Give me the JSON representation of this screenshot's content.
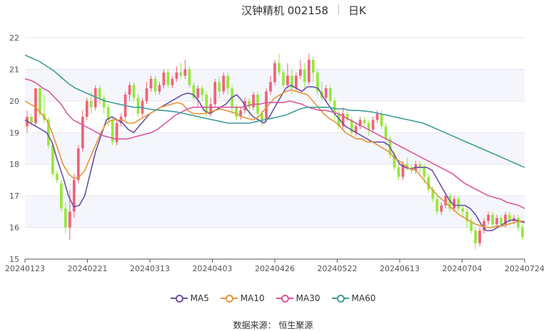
{
  "header": {
    "title": "汉钟精机 002158",
    "period": "日K"
  },
  "source_label": "数据来源：  恒生聚源",
  "colors": {
    "up": "#f0627a",
    "down": "#96e83c",
    "MA5": "#6b4fa6",
    "MA10": "#e8943a",
    "MA30": "#d9589f",
    "MA60": "#3f9c9a"
  },
  "chart_data": {
    "type": "candlestick",
    "ylim": [
      15,
      22
    ],
    "yticks": [
      "15",
      "16",
      "17",
      "18",
      "19",
      "20",
      "21",
      "22"
    ],
    "xticks": [
      "20240123",
      "20240221",
      "20240313",
      "20240403",
      "20240426",
      "20240522",
      "20240613",
      "20240704",
      "20240724"
    ],
    "candles": [
      [
        19.2,
        19.5,
        19.7,
        19.0
      ],
      [
        19.5,
        19.3,
        19.6,
        19.2
      ],
      [
        19.3,
        20.4,
        20.4,
        19.2
      ],
      [
        20.4,
        19.6,
        20.5,
        19.5
      ],
      [
        19.6,
        19.4,
        20.2,
        19.3
      ],
      [
        19.4,
        18.6,
        19.5,
        18.5
      ],
      [
        18.6,
        17.7,
        18.7,
        17.6
      ],
      [
        17.7,
        17.5,
        17.8,
        17.4
      ],
      [
        17.4,
        16.6,
        17.5,
        16.5
      ],
      [
        16.6,
        16.0,
        16.8,
        15.8
      ],
      [
        16.0,
        16.5,
        17.2,
        15.6
      ],
      [
        16.5,
        17.5,
        17.7,
        16.3
      ],
      [
        17.5,
        18.5,
        18.6,
        17.4
      ],
      [
        18.5,
        19.5,
        19.7,
        18.4
      ],
      [
        19.5,
        20.0,
        20.1,
        19.4
      ],
      [
        20.0,
        19.8,
        20.3,
        19.6
      ],
      [
        19.8,
        20.4,
        20.5,
        19.7
      ],
      [
        20.4,
        20.1,
        20.5,
        19.9
      ],
      [
        20.1,
        19.8,
        20.2,
        19.6
      ],
      [
        19.8,
        19.4,
        19.9,
        19.2
      ],
      [
        19.4,
        18.7,
        19.5,
        18.6
      ],
      [
        18.7,
        19.3,
        19.4,
        18.6
      ],
      [
        19.3,
        19.5,
        19.6,
        19.2
      ],
      [
        19.5,
        20.2,
        20.3,
        19.4
      ],
      [
        20.2,
        20.5,
        20.6,
        20.0
      ],
      [
        20.5,
        20.1,
        20.6,
        20.0
      ],
      [
        20.1,
        19.6,
        20.2,
        19.5
      ],
      [
        19.6,
        20.0,
        20.1,
        19.5
      ],
      [
        20.0,
        20.4,
        20.6,
        19.9
      ],
      [
        20.4,
        20.7,
        20.8,
        20.3
      ],
      [
        20.7,
        20.3,
        20.8,
        20.2
      ],
      [
        20.3,
        20.5,
        20.6,
        20.2
      ],
      [
        20.5,
        20.9,
        21.0,
        20.4
      ],
      [
        20.9,
        20.5,
        21.0,
        20.4
      ],
      [
        20.5,
        20.7,
        20.8,
        20.4
      ],
      [
        20.7,
        20.9,
        21.1,
        20.6
      ],
      [
        20.9,
        20.8,
        21.2,
        20.7
      ],
      [
        20.8,
        21.0,
        21.3,
        20.7
      ],
      [
        21.0,
        20.5,
        21.1,
        20.4
      ],
      [
        20.5,
        20.1,
        20.6,
        20.0
      ],
      [
        20.1,
        20.4,
        20.5,
        19.8
      ],
      [
        20.4,
        20.2,
        20.5,
        20.0
      ],
      [
        20.2,
        19.6,
        20.3,
        19.5
      ],
      [
        19.6,
        19.9,
        20.1,
        19.5
      ],
      [
        19.9,
        20.6,
        20.7,
        19.8
      ],
      [
        20.6,
        20.3,
        20.8,
        20.1
      ],
      [
        20.3,
        20.8,
        20.9,
        20.2
      ],
      [
        20.8,
        20.4,
        20.9,
        20.2
      ],
      [
        20.4,
        19.8,
        20.5,
        19.6
      ],
      [
        19.8,
        19.5,
        19.9,
        19.4
      ],
      [
        19.5,
        19.7,
        19.8,
        19.4
      ],
      [
        19.7,
        20.0,
        20.1,
        19.6
      ],
      [
        20.0,
        19.8,
        20.1,
        19.5
      ],
      [
        19.8,
        20.2,
        20.3,
        19.7
      ],
      [
        20.2,
        19.6,
        20.3,
        19.4
      ],
      [
        19.6,
        19.4,
        19.7,
        19.2
      ],
      [
        19.4,
        20.3,
        20.4,
        19.3
      ],
      [
        20.3,
        20.6,
        20.8,
        20.2
      ],
      [
        20.6,
        21.2,
        21.3,
        20.5
      ],
      [
        21.2,
        20.9,
        21.5,
        20.8
      ],
      [
        20.9,
        20.5,
        21.0,
        20.4
      ],
      [
        20.5,
        20.8,
        21.2,
        20.4
      ],
      [
        20.8,
        20.4,
        21.0,
        20.2
      ],
      [
        20.4,
        20.8,
        20.9,
        20.3
      ],
      [
        20.8,
        21.0,
        21.3,
        20.7
      ],
      [
        21.0,
        20.6,
        21.2,
        20.4
      ],
      [
        20.6,
        21.3,
        21.5,
        20.5
      ],
      [
        21.3,
        20.9,
        21.4,
        20.6
      ],
      [
        20.9,
        20.3,
        21.0,
        20.2
      ],
      [
        20.3,
        20.1,
        20.6,
        20.0
      ],
      [
        20.1,
        20.4,
        20.5,
        20.0
      ],
      [
        20.4,
        20.0,
        20.5,
        19.9
      ],
      [
        20.0,
        19.6,
        20.1,
        19.4
      ],
      [
        19.6,
        19.2,
        19.7,
        19.1
      ],
      [
        19.2,
        19.6,
        19.8,
        19.1
      ],
      [
        19.6,
        19.4,
        19.7,
        19.3
      ],
      [
        19.4,
        19.0,
        19.5,
        18.9
      ],
      [
        19.0,
        19.2,
        19.3,
        18.9
      ],
      [
        19.2,
        19.4,
        19.5,
        19.1
      ],
      [
        19.4,
        19.3,
        19.5,
        19.2
      ],
      [
        19.3,
        19.1,
        19.4,
        18.9
      ],
      [
        19.1,
        19.4,
        19.5,
        19.0
      ],
      [
        19.4,
        19.6,
        19.7,
        19.3
      ],
      [
        19.6,
        19.2,
        19.7,
        19.1
      ],
      [
        19.2,
        18.8,
        19.3,
        18.6
      ],
      [
        18.8,
        18.3,
        18.9,
        18.2
      ],
      [
        18.3,
        17.9,
        18.4,
        17.8
      ],
      [
        17.9,
        17.6,
        18.0,
        17.5
      ],
      [
        17.6,
        18.0,
        18.1,
        17.5
      ],
      [
        18.0,
        17.9,
        18.2,
        17.8
      ],
      [
        17.9,
        17.8,
        18.0,
        17.7
      ],
      [
        17.8,
        18.0,
        18.1,
        17.7
      ],
      [
        18.0,
        17.9,
        18.1,
        17.7
      ],
      [
        17.9,
        17.6,
        18.0,
        17.4
      ],
      [
        17.6,
        17.2,
        17.7,
        17.1
      ],
      [
        17.2,
        16.9,
        17.3,
        16.8
      ],
      [
        16.9,
        16.5,
        17.0,
        16.4
      ],
      [
        16.5,
        16.7,
        16.8,
        16.4
      ],
      [
        16.7,
        17.0,
        17.1,
        16.6
      ],
      [
        17.0,
        16.6,
        17.1,
        16.5
      ],
      [
        16.6,
        16.9,
        17.0,
        16.5
      ],
      [
        16.9,
        16.6,
        17.0,
        16.5
      ],
      [
        16.6,
        16.5,
        16.7,
        16.3
      ],
      [
        16.5,
        16.2,
        16.6,
        16.0
      ],
      [
        16.2,
        15.9,
        16.3,
        15.8
      ],
      [
        15.9,
        15.5,
        16.0,
        15.3
      ],
      [
        15.5,
        15.9,
        16.0,
        15.4
      ],
      [
        15.9,
        16.2,
        16.3,
        15.8
      ],
      [
        16.2,
        16.4,
        16.5,
        16.1
      ],
      [
        16.4,
        16.1,
        16.5,
        16.0
      ],
      [
        16.1,
        16.3,
        16.4,
        16.0
      ],
      [
        16.3,
        16.1,
        16.4,
        16.0
      ],
      [
        16.1,
        16.4,
        16.5,
        16.0
      ],
      [
        16.4,
        16.2,
        16.5,
        16.1
      ],
      [
        16.2,
        16.3,
        16.4,
        16.1
      ],
      [
        16.3,
        16.0,
        16.4,
        15.9
      ],
      [
        16.0,
        15.7,
        16.1,
        15.6
      ]
    ],
    "series": [
      {
        "name": "MA5",
        "values": [
          19.4,
          19.3,
          19.2,
          19.1,
          19.0,
          18.7,
          18.1,
          17.6,
          17.0,
          16.65,
          16.7,
          17.0,
          17.7,
          18.4,
          18.9,
          19.4,
          19.5,
          19.4,
          19.3,
          19.1,
          19.0,
          19.2,
          19.4,
          19.6,
          19.7,
          19.8,
          19.9,
          20.0,
          20.1,
          20.2,
          20.25,
          20.2,
          20.0,
          19.7,
          19.6,
          19.7,
          19.8,
          19.9,
          20.1,
          20.2,
          20.0,
          19.7,
          19.5,
          19.4,
          19.3,
          19.5,
          19.8,
          20.1,
          20.4,
          20.5,
          20.4,
          20.3,
          20.45,
          20.45,
          20.4,
          20.1,
          19.85,
          19.6,
          19.4,
          19.2,
          19.1,
          19.0,
          18.9,
          18.8,
          18.7,
          18.7,
          18.7,
          18.6,
          18.3,
          18.0,
          17.9,
          17.85,
          17.9,
          17.9,
          17.9,
          17.8,
          17.5,
          17.2,
          16.9,
          16.7,
          16.7,
          16.7,
          16.6,
          16.4,
          16.1,
          15.9,
          15.9,
          16.0,
          16.1,
          16.2,
          16.25,
          16.2,
          16.15
        ]
      },
      {
        "name": "MA10",
        "values": [
          20.0,
          19.9,
          19.8,
          19.6,
          19.4,
          19.0,
          18.5,
          18.0,
          17.7,
          17.55,
          17.6,
          17.8,
          18.2,
          18.6,
          19.0,
          19.3,
          19.4,
          19.4,
          19.4,
          19.3,
          19.3,
          19.4,
          19.5,
          19.6,
          19.7,
          19.8,
          19.85,
          19.9,
          19.95,
          19.9,
          19.7,
          19.6,
          19.6,
          19.6,
          19.65,
          19.7,
          19.75,
          19.7,
          19.65,
          19.6,
          19.5,
          19.45,
          19.4,
          19.5,
          19.7,
          19.9,
          20.1,
          20.2,
          20.3,
          20.35,
          20.3,
          20.25,
          20.2,
          20.0,
          19.8,
          19.6,
          19.45,
          19.35,
          19.2,
          19.0,
          18.9,
          18.8,
          18.8,
          18.7,
          18.7,
          18.6,
          18.5,
          18.4,
          18.2,
          18.1,
          17.95,
          17.85,
          17.8,
          17.6,
          17.4,
          17.2,
          17.0,
          16.85,
          16.7,
          16.55,
          16.4,
          16.3,
          16.2,
          16.1,
          16.05,
          16.0,
          16.0,
          16.05,
          16.05,
          16.1,
          16.15,
          16.2,
          16.2
        ]
      },
      {
        "name": "MA30",
        "values": [
          20.7,
          20.65,
          20.55,
          20.4,
          20.3,
          20.1,
          19.9,
          19.6,
          19.4,
          19.3,
          19.2,
          19.1,
          19.0,
          18.9,
          18.85,
          18.8,
          18.8,
          18.8,
          18.85,
          18.9,
          18.95,
          19.0,
          19.1,
          19.25,
          19.4,
          19.55,
          19.65,
          19.75,
          19.8,
          19.8,
          19.8,
          19.8,
          19.8,
          19.8,
          19.8,
          19.8,
          19.8,
          19.85,
          19.9,
          19.9,
          19.95,
          19.95,
          19.95,
          19.95,
          20.0,
          19.95,
          19.9,
          19.8,
          19.75,
          19.7,
          19.7,
          19.65,
          19.6,
          19.5,
          19.4,
          19.3,
          19.2,
          19.1,
          19.0,
          18.9,
          18.8,
          18.7,
          18.6,
          18.5,
          18.4,
          18.3,
          18.2,
          18.1,
          18.0,
          17.9,
          17.8,
          17.7,
          17.55,
          17.4,
          17.3,
          17.2,
          17.1,
          17.0,
          16.95,
          16.9,
          16.8,
          16.75,
          16.7,
          16.6
        ]
      },
      {
        "name": "MA60",
        "values": [
          21.45,
          21.35,
          21.25,
          21.1,
          20.95,
          20.75,
          20.55,
          20.4,
          20.3,
          20.2,
          20.1,
          20.0,
          19.95,
          19.9,
          19.85,
          19.8,
          19.8,
          19.75,
          19.72,
          19.7,
          19.68,
          19.65,
          19.6,
          19.55,
          19.5,
          19.45,
          19.4,
          19.35,
          19.3,
          19.3,
          19.3,
          19.3,
          19.35,
          19.4,
          19.45,
          19.5,
          19.55,
          19.65,
          19.75,
          19.8,
          19.8,
          19.8,
          19.8,
          19.75,
          19.75,
          19.7,
          19.7,
          19.68,
          19.65,
          19.6,
          19.55,
          19.5,
          19.45,
          19.4,
          19.35,
          19.3,
          19.2,
          19.1,
          19.0,
          18.9,
          18.8,
          18.7,
          18.6,
          18.5,
          18.4,
          18.3,
          18.2,
          18.1,
          18.0,
          17.9
        ]
      }
    ]
  }
}
